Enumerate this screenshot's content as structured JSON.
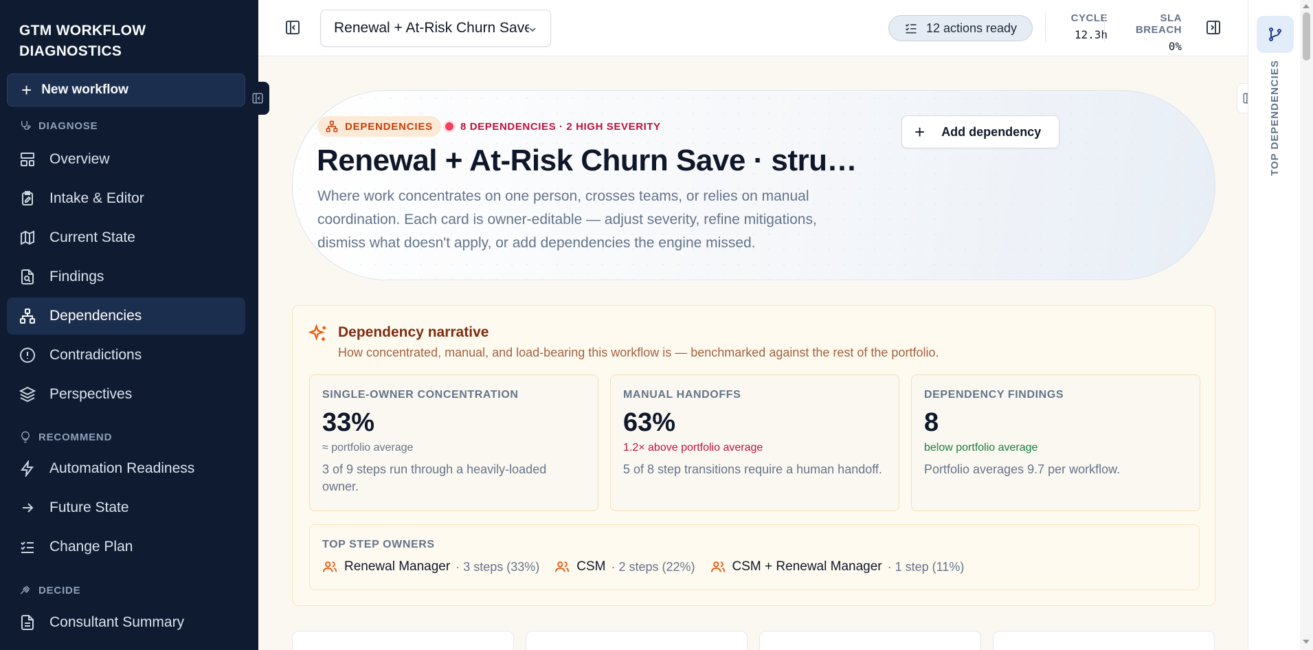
{
  "sidebar": {
    "brand": "GTM WORKFLOW\nDIAGNOSTICS",
    "new_workflow": "New workflow",
    "sections": {
      "diagnose": "DIAGNOSE",
      "recommend": "RECOMMEND",
      "decide": "DECIDE"
    },
    "items": {
      "overview": "Overview",
      "intake": "Intake & Editor",
      "current_state": "Current State",
      "findings": "Findings",
      "dependencies": "Dependencies",
      "contradictions": "Contradictions",
      "perspectives": "Perspectives",
      "automation": "Automation Readiness",
      "future_state": "Future State",
      "change_plan": "Change Plan",
      "consultant_summary": "Consultant Summary"
    },
    "active": "dependencies"
  },
  "topbar": {
    "workflow_select": "Renewal + At-Risk Churn Save",
    "actions_ready": "12 actions ready",
    "cycle_label": "CYCLE",
    "cycle_value": "12.3h",
    "sla_label": "SLA BREACH",
    "sla_value": "0%"
  },
  "rail": {
    "label": "TOP DEPENDENCIES"
  },
  "hero": {
    "badge": "DEPENDENCIES",
    "severity": "8 DEPENDENCIES · 2 HIGH SEVERITY",
    "title": "Renewal + At-Risk Churn Save · stru…",
    "description": "Where work concentrates on one person, crosses teams, or relies on manual coordination. Each card is owner-editable — adjust severity, refine mitigations, dismiss what doesn't apply, or add dependencies the engine missed.",
    "add_button": "Add dependency"
  },
  "narrative": {
    "title": "Dependency narrative",
    "subtitle": "How concentrated, manual, and load-bearing this workflow is — benchmarked against the rest of the portfolio.",
    "cards": [
      {
        "label": "SINGLE-OWNER CONCENTRATION",
        "value": "33%",
        "tag": "≈ portfolio average",
        "desc": "3 of 9 steps run through a heavily-loaded owner."
      },
      {
        "label": "MANUAL HANDOFFS",
        "value": "63%",
        "tag": "1.2× above portfolio average",
        "desc": "5 of 8 step transitions require a human handoff."
      },
      {
        "label": "DEPENDENCY FINDINGS",
        "value": "8",
        "tag": "below portfolio average",
        "desc": "Portfolio averages 9.7 per workflow."
      }
    ],
    "owners_label": "TOP STEP OWNERS",
    "owners": [
      {
        "name": "Renewal Manager",
        "meta": "· 3 steps (33%)"
      },
      {
        "name": "CSM",
        "meta": "· 2 steps (22%)"
      },
      {
        "name": "CSM + Renewal Manager",
        "meta": "· 1 step (11%)"
      }
    ]
  },
  "colors": {
    "sidebar_bg": "#0f1b30",
    "accent_orange": "#c2410c",
    "alert_red": "#be123c",
    "positive_green": "#15803d"
  }
}
